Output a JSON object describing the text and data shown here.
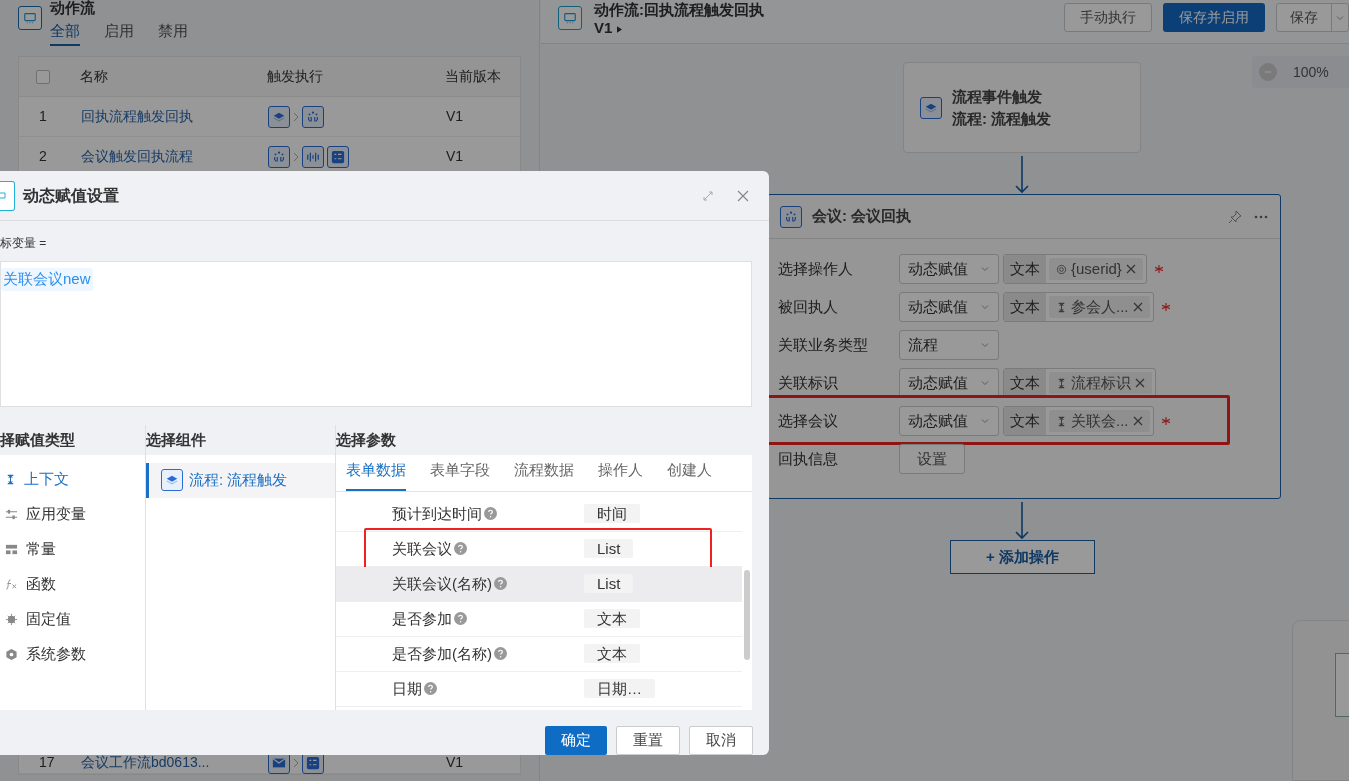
{
  "list_panel": {
    "title": "动作流",
    "tabs": [
      {
        "label": "全部",
        "selected": true
      },
      {
        "label": "启用",
        "selected": false
      },
      {
        "label": "禁用",
        "selected": false
      }
    ],
    "all_selected": false,
    "columns": [
      "名称",
      "触发执行",
      "当前版本"
    ],
    "rows": [
      {
        "index": "1",
        "name": "回执流程触发回执",
        "triggers": [
          {
            "kind": "layers"
          },
          {
            "kind": "meeting"
          }
        ],
        "version": "V1"
      },
      {
        "index": "2",
        "name": "会议触发回执流程",
        "triggers": [
          {
            "kind": "meeting"
          },
          {
            "kind": "signal"
          },
          {
            "kind": "checklist"
          }
        ],
        "version": "V1"
      },
      {
        "index": "17",
        "name": "会议工作流bd0613...",
        "triggers": [
          {
            "kind": "mail"
          },
          {
            "kind": "checklist"
          }
        ],
        "version": "V1"
      }
    ]
  },
  "editor": {
    "title": "动作流:回执流程触发回执",
    "version": "V1",
    "buttons": [
      "手动执行",
      "保存并启用",
      "保存"
    ],
    "zoom": "100%",
    "trigger_node": {
      "title": "流程事件触发",
      "subtitle": "流程: 流程触发"
    },
    "action_node": {
      "title": "会议: 会议回执",
      "fields": [
        {
          "label": "选择操作人",
          "kind": "dynamic",
          "mode": "动态赋值",
          "type": "文本",
          "value": "{userid}",
          "required": true,
          "highlighted": false
        },
        {
          "label": "被回执人",
          "kind": "dynamic",
          "mode": "动态赋值",
          "type": "文本",
          "value": "参会人...",
          "required": true,
          "highlighted": false
        },
        {
          "label": "关联业务类型",
          "kind": "select",
          "mode": "流程",
          "required": false,
          "highlighted": false
        },
        {
          "label": "关联标识",
          "kind": "dynamic",
          "mode": "动态赋值",
          "type": "文本",
          "value": "流程标识",
          "required": false,
          "highlighted": false
        },
        {
          "label": "选择会议",
          "kind": "dynamic",
          "mode": "动态赋值",
          "type": "文本",
          "value": "关联会...",
          "required": true,
          "highlighted": true
        },
        {
          "label": "回执信息",
          "kind": "button",
          "mode": "设置",
          "required": false,
          "highlighted": false
        }
      ]
    },
    "add_button": "+ 添加操作"
  },
  "dialog": {
    "title": "动态赋值设置",
    "target_label": "标变量 =",
    "token": "关联会议new",
    "type_heading": "择赋值类型",
    "types": [
      {
        "label": "上下文",
        "selected": true
      },
      {
        "label": "应用变量",
        "selected": false
      },
      {
        "label": "常量",
        "selected": false
      },
      {
        "label": "函数",
        "selected": false
      },
      {
        "label": "固定值",
        "selected": false
      },
      {
        "label": "系统参数",
        "selected": false
      }
    ],
    "component_heading": "选择组件",
    "components": [
      {
        "label": "流程: 流程触发",
        "selected": true
      }
    ],
    "param_heading": "选择参数",
    "param_tabs": [
      {
        "label": "表单数据",
        "selected": true
      },
      {
        "label": "表单字段",
        "selected": false
      },
      {
        "label": "流程数据",
        "selected": false
      },
      {
        "label": "操作人",
        "selected": false
      },
      {
        "label": "创建人",
        "selected": false
      }
    ],
    "params": [
      {
        "name": "预计到达时间",
        "type": "时间",
        "hovered": false,
        "highlighted": false
      },
      {
        "name": "关联会议",
        "type": "List",
        "hovered": false,
        "highlighted": true
      },
      {
        "name": "关联会议(名称)",
        "type": "List",
        "hovered": true,
        "highlighted": false
      },
      {
        "name": "是否参加",
        "type": "文本",
        "hovered": false,
        "highlighted": false
      },
      {
        "name": "是否参加(名称)",
        "type": "文本",
        "hovered": false,
        "highlighted": false
      },
      {
        "name": "日期",
        "type": "日期…",
        "hovered": false,
        "highlighted": false
      }
    ],
    "buttons": [
      {
        "label": "确定",
        "kind": "primary"
      },
      {
        "label": "重置",
        "kind": "default"
      },
      {
        "label": "取消",
        "kind": "default"
      }
    ]
  }
}
